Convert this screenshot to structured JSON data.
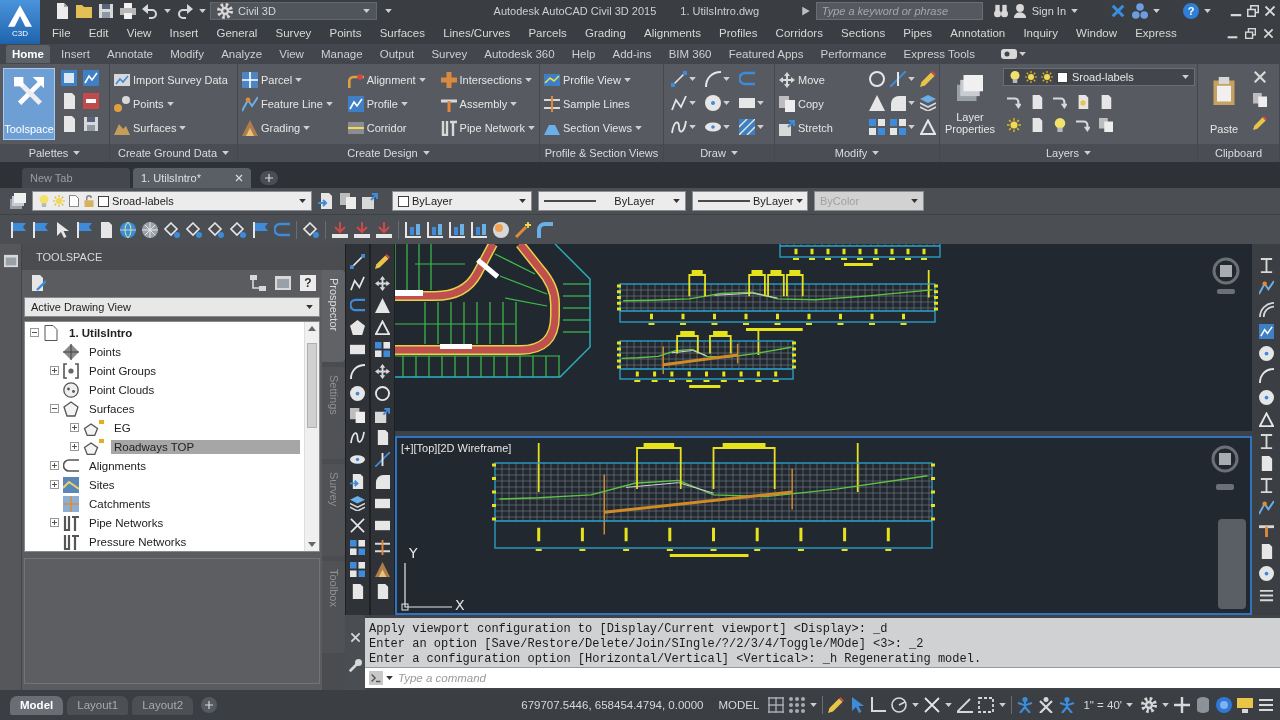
{
  "title_bar": {
    "badge": "C3D",
    "workspace": "Civil 3D",
    "title": "Autodesk AutoCAD Civil 3D 2015",
    "file": "1. UtilsIntro.dwg",
    "search": {
      "placeholder": "Type a keyword or phrase"
    },
    "sign_in": "Sign In",
    "help": "?"
  },
  "menu_bar": [
    "File",
    "Edit",
    "View",
    "Insert",
    "General",
    "Survey",
    "Points",
    "Surfaces",
    "Lines/Curves",
    "Parcels",
    "Grading",
    "Alignments",
    "Profiles",
    "Corridors",
    "Sections",
    "Pipes",
    "Annotation",
    "Inquiry",
    "Window",
    "Express"
  ],
  "ribbon_tabs": [
    {
      "label": "Home",
      "selected": true
    },
    {
      "label": "Insert",
      "selected": false
    },
    {
      "label": "Annotate",
      "selected": false
    },
    {
      "label": "Modify",
      "selected": false
    },
    {
      "label": "Analyze",
      "selected": false
    },
    {
      "label": "View",
      "selected": false
    },
    {
      "label": "Manage",
      "selected": false
    },
    {
      "label": "Output",
      "selected": false
    },
    {
      "label": "Survey",
      "selected": false
    },
    {
      "label": "Autodesk 360",
      "selected": false
    },
    {
      "label": "Help",
      "selected": false
    },
    {
      "label": "Add-ins",
      "selected": false
    },
    {
      "label": "BIM 360",
      "selected": false
    },
    {
      "label": "Featured Apps",
      "selected": false
    },
    {
      "label": "Performance",
      "selected": false
    },
    {
      "label": "Express Tools",
      "selected": false
    }
  ],
  "ribbon_panels": [
    {
      "kind": "palettes",
      "title": "Palettes",
      "menu": true,
      "big_button": {
        "label": "Toolspace",
        "on": true
      }
    },
    {
      "kind": "commands",
      "title": "Create Ground Data",
      "menu": true,
      "columns": [
        [
          {
            "label": "Import Survey Data",
            "menu": false
          },
          {
            "label": "Points",
            "menu": true
          },
          {
            "label": "Surfaces",
            "menu": true
          }
        ]
      ]
    },
    {
      "kind": "commands",
      "title": "Create Design",
      "menu": true,
      "columns": [
        [
          {
            "label": "Parcel",
            "menu": true
          },
          {
            "label": "Feature Line",
            "menu": true
          },
          {
            "label": "Grading",
            "menu": true
          }
        ],
        [
          {
            "label": "Alignment",
            "menu": true
          },
          {
            "label": "Profile",
            "menu": true
          },
          {
            "label": "Corridor",
            "menu": false
          }
        ],
        [
          {
            "label": "Intersections",
            "menu": true
          },
          {
            "label": "Assembly",
            "menu": true
          },
          {
            "label": "Pipe Network",
            "menu": true
          }
        ]
      ]
    },
    {
      "kind": "commands",
      "title": "Profile & Section Views",
      "menu": false,
      "columns": [
        [
          {
            "label": "Profile View",
            "menu": true
          },
          {
            "label": "Sample Lines",
            "menu": false
          },
          {
            "label": "Section Views",
            "menu": true
          }
        ]
      ]
    },
    {
      "kind": "draw",
      "title": "Draw",
      "menu": true
    },
    {
      "kind": "modify",
      "title": "Modify",
      "menu": true,
      "columns": [
        [
          {
            "label": "Move",
            "menu": false
          },
          {
            "label": "Copy",
            "menu": false
          },
          {
            "label": "Stretch",
            "menu": false
          }
        ]
      ]
    },
    {
      "kind": "layers",
      "title": "Layers",
      "menu": true,
      "big_button": {
        "label": "Layer Properties",
        "on": false
      },
      "layer": "Sroad-labels"
    },
    {
      "kind": "clipboard",
      "title": "Clipboard",
      "menu": false,
      "big_button": {
        "label": "Paste",
        "on": false
      }
    }
  ],
  "document_tabs": [
    {
      "label": "New Tab",
      "selected": false
    },
    {
      "label": "1. UtilsIntro*",
      "selected": true
    }
  ],
  "properties_toolbar": {
    "layer": "Sroad-labels",
    "dropdowns": [
      {
        "kind": "swatch",
        "value": "ByLayer",
        "disabled": false
      },
      {
        "kind": "line",
        "value": "ByLayer",
        "disabled": false
      },
      {
        "kind": "line",
        "value": "ByLayer",
        "disabled": false
      },
      {
        "kind": "plain",
        "value": "ByColor",
        "disabled": true
      }
    ]
  },
  "toolspace": {
    "title": "TOOLSPACE",
    "help": "?",
    "view": "Active Drawing View",
    "tree": [
      {
        "label": "1. UtilsIntro",
        "kind": "drawing",
        "expanded": true,
        "selected": false,
        "children": [
          {
            "label": "Points",
            "kind": "points",
            "selected": false
          },
          {
            "label": "Point Groups",
            "kind": "groups",
            "expanded": false,
            "selected": false
          },
          {
            "label": "Point Clouds",
            "kind": "clouds",
            "selected": false
          },
          {
            "label": "Surfaces",
            "kind": "surfaces",
            "expanded": true,
            "selected": false,
            "children": [
              {
                "label": "EG",
                "kind": "surface",
                "expanded": false,
                "selected": false
              },
              {
                "label": "Roadways TOP",
                "kind": "surface",
                "expanded": false,
                "selected": true
              }
            ]
          },
          {
            "label": "Alignments",
            "kind": "alignments",
            "expanded": false,
            "selected": false
          },
          {
            "label": "Sites",
            "kind": "sites",
            "expanded": false,
            "selected": false
          },
          {
            "label": "Catchments",
            "kind": "catchments",
            "selected": false
          },
          {
            "label": "Pipe Networks",
            "kind": "pipes",
            "expanded": false,
            "selected": false
          },
          {
            "label": "Pressure Networks",
            "kind": "pressure",
            "selected": false
          }
        ]
      }
    ],
    "tabs": [
      {
        "label": "Prospector",
        "selected": true
      },
      {
        "label": "Settings",
        "selected": false
      },
      {
        "label": "Survey",
        "selected": false
      },
      {
        "label": "Toolbox",
        "selected": false
      }
    ]
  },
  "viewports": [
    {
      "active": false
    },
    {
      "active": true,
      "label": "[+][Top][2D Wireframe]",
      "ucs": {
        "x": "X",
        "y": "Y"
      }
    }
  ],
  "command_line": {
    "history": [
      "Apply viewport configuration to [Display/Current viewport] <Display>: _d",
      "Enter an option [Save/Restore/Delete/Join/SIngle/?/2/3/4/Toggle/MOde] <3>: _2",
      "Enter a configuration option [Horizontal/Vertical] <Vertical>: _h Regenerating model."
    ],
    "input": {
      "placeholder": "Type a command"
    }
  },
  "status_bar": {
    "layout_tabs": [
      {
        "label": "Model",
        "selected": true
      },
      {
        "label": "Layout1",
        "selected": false
      },
      {
        "label": "Layout2",
        "selected": false
      }
    ],
    "coordinates": "679707.5446, 658454.4794, 0.0000",
    "space": "MODEL",
    "scale": "1\" = 40'"
  }
}
